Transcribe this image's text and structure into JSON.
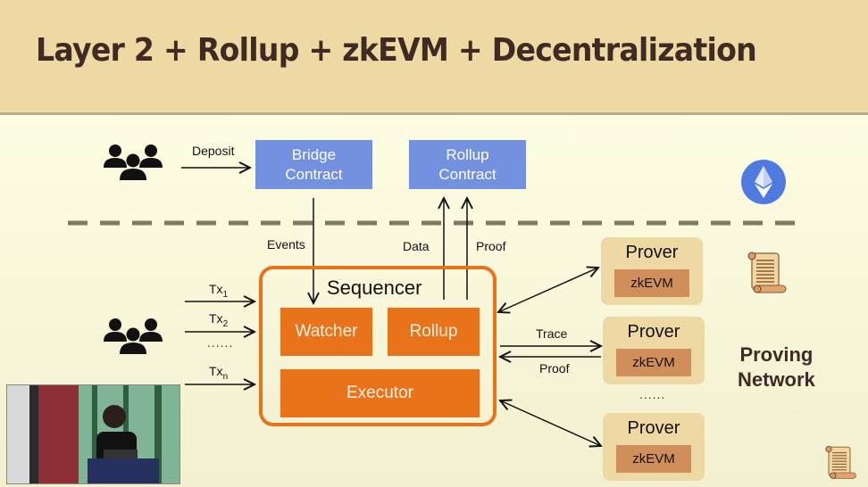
{
  "slide": {
    "title": "Layer 2 + Rollup + zkEVM + Decentralization"
  },
  "layer1": {
    "deposit_label": "Deposit",
    "bridge_contract": "Bridge Contract",
    "rollup_contract": "Rollup Contract",
    "icons": [
      "users-icon",
      "ethereum-icon"
    ]
  },
  "layer2": {
    "events_label": "Events",
    "data_label": "Data",
    "proof_label": "Proof",
    "tx_labels": [
      {
        "base": "Tx",
        "sub": "1"
      },
      {
        "base": "Tx",
        "sub": "2"
      },
      {
        "base": "Tx",
        "sub": "n"
      }
    ],
    "tx_ellipsis": "......",
    "sequencer": {
      "title": "Sequencer",
      "watcher": "Watcher",
      "rollup": "Rollup",
      "executor": "Executor"
    },
    "trace_label": "Trace",
    "trace_proof_label": "Proof"
  },
  "proving_network": {
    "title_line1": "Proving",
    "title_line2": "Network",
    "provers": [
      {
        "label": "Prover",
        "engine": "zkEVM"
      },
      {
        "label": "Prover",
        "engine": "zkEVM"
      },
      {
        "label": "Prover",
        "engine": "zkEVM"
      }
    ],
    "ellipsis": "......"
  },
  "colors": {
    "header_bg": "#eed9a4",
    "title_text": "#3f2b24",
    "contract_blue": "#7391de",
    "sequencer_orange": "#e9731a",
    "prover_bg": "#eed9a4",
    "zkevm_bg": "#d08f5a",
    "ethereum_blue": "#4f7be0"
  }
}
